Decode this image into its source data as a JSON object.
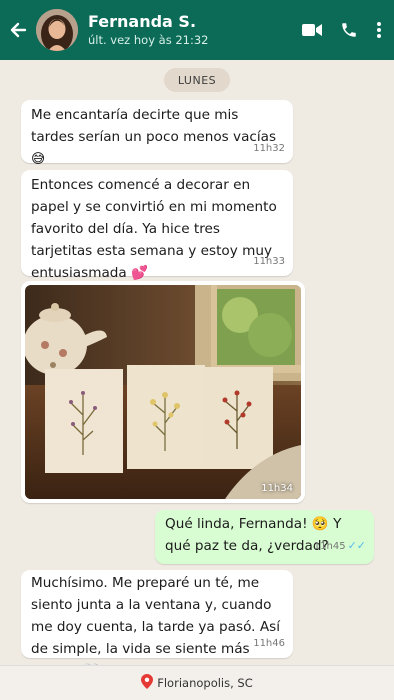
{
  "contact": {
    "name": "Fernanda S.",
    "status": "últ. vez hoy às 21:32"
  },
  "icons": {
    "back": "back-arrow-icon",
    "video": "video-call-icon",
    "call": "phone-call-icon",
    "menu": "more-options-icon",
    "location": "location-pin-icon",
    "read": "double-check-icon"
  },
  "colors": {
    "header": "#0b6b57",
    "incoming": "#ffffff",
    "outgoing": "#d9fdd3",
    "chat_bg": "#efeae2",
    "read_tick": "#53bdeb"
  },
  "day_label": "LUNES",
  "messages": [
    {
      "text": "Me encantaría decirte que mis tardes serían un poco menos vacías 😅",
      "time": "11h32"
    },
    {
      "text": "Entonces comencé a decorar en papel y se convirtió en mi momento favorito del día. Ya hice tres tarjetitas esta semana y estoy muy entusiasmada 💕",
      "time": "11h33"
    },
    {
      "time": "11h34"
    },
    {
      "text": "Qué linda, Fernanda! 🥺 Y qué paz te da, ¿verdad?",
      "time": "11h45"
    },
    {
      "text": "Muchísimo. Me preparé un té, me siento junta a la ventana y, cuando me doy cuenta, la tarde ya pasó. Así de simple, la vida se siente más bonita. 🤍",
      "time": "11h46"
    }
  ],
  "footer": {
    "location": "Florianopolis, SC"
  }
}
